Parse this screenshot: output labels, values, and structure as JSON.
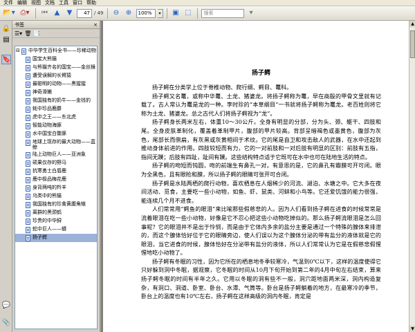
{
  "menu": [
    "文件",
    "编辑",
    "视图",
    "文档",
    "工具",
    "窗口",
    "帮助"
  ],
  "toolbar": {
    "page_current": "47",
    "page_total": "/ 49",
    "zoom": "100%",
    "search_placeholder": "搜索"
  },
  "bookmarks": {
    "panel_title": "书签",
    "close_glyph": "×",
    "root_label": "中华学生百科全书——珍稀动物",
    "items": [
      "国宝大熊猫",
      "与熊猫齐名的国宝——金丝猴",
      "遭受误解的长臂猿",
      "最聪明的动物——黑猩猩",
      "神奇滑獭",
      "我国独有的奶牛——金钱豹",
      "蚝中珍品鹿麝",
      "虎中之王——东北虎",
      "智能动物海豚",
      "水中国宝白鳖豚",
      "地球上现存的最大动物——蓝鲸",
      "陆上动物巨人——亚洲象",
      "硕果仅存的野马",
      "抗寒勇士白唇鹿",
      "鹿中极品梅花鹿",
      "身背两吨的羚羊",
      "乌类中的熊猫",
      "我国独有的珍禽黄腹角雉",
      "离群的黑颈鹤",
      "珍贵的中华鲟",
      "蛇中巨人——蟒",
      "扬子鳄"
    ],
    "selected_index": 21
  },
  "document": {
    "title": "扬子鳄",
    "paragraphs": [
      "扬子鳄在分类学上位于脊椎动物、爬行纲、鳄目、鼍科。",
      "扬子鳄又名鼍，或称中华鼍、土龙、猪婆龙。将扬子鳄称为鼍，早在商殷的甲骨文里就有记载了。古人常认为鼍是龙的一种。李时珍的“本草纲目”一书就将扬子鳄称为鼍龙。老百姓则将它称为土龙、猪婆龙。总之古代人们将扬子鳄视为“龙”。",
      "扬子鳄身长两米左右，体重10～30公斤。全身有明显的分部，分为头、颈、躯干、四肢和尾。全身皮肤革制化，覆盖着革制甲片，腹部的甲片较高。背部呈暗褐色或墨黄色，腹部为灰色，尾部长而侧扁，有灰黑或灰黄相间于术纹。它的尾是自卫和攻击敌人的武器，在水中还起到推动身体前进的作用。四肢较短而有力，它的一对前肢和一对后肢有明显的区别：前肢有五指，指间无蹼；后肢有四趾，趾间有蹼。这些结构特点适于它既可在水中也可在陆地生活的特点。",
      "扬子鳄的吻短而钝圆，吻的前端生有鼻孔一对。有意思的是，它的鼻孔有瓣膜可开可闭。眼为全黑色，且有眼睑和膜，所以扬子鳄的眼睛可张开可合闭。",
      "扬子鳄是水陆两栖的爬行动物，喜欢栖息在人烟稀少的河流、湖泊、水塘之中。它大多在夜间活动、觅食，主要吃一些小动物，如鱼、虾、鼠类、河蚌和小鸟等。它还爱饥饿的能力很强，能连续几个月不进食。",
      "人们常常用“鳄鱼的眼泪”来比喻那些假慈悲的人。因为人们看到扬子鳄在进食的时候常常是流着眼泪在吃一些小动物，好像是它不忍心把这些小动物吃掉似的。那么扬子鳄流眼泪是怎么回事呢？它的眼泪并不是出于怜悯，而是由于它体内多余的盐分主要是通过一个特殊的腺体来排泄的，而这个腺体恰好位于它的眼睛旁边，使人们误以为这个腺体分泌的带有盐分的液体就是它的眼泪，当它进食的时候，腺体恰好在分泌带有盐分的液体，所以人们常常认为它是在假慈悲假惺惺地吃小动物了。",
      "扬子鳄有冬眠的习性，因为它所在的栖息地冬季较寒冷，气温到0℃以下，这样的温度使得它只好躲到洞中冬眠，据观察，它冬眠的时间从10月下旬开始到第二年的4月中旬左右结束，算来扬子鳄冬眠的时间有半年之久。它用以冬眠的洞有些不一般，洞穴距地面两米深，洞内构造复杂，有洞口、洞道、卧室、卧台、水潭、气筒等。卧台是扬子鳄躺着的地方，在最寒冷的季节，卧台上的温度也有10℃左右，扬子鳄在这样高级的洞内冬眠，肯定是"
    ]
  }
}
